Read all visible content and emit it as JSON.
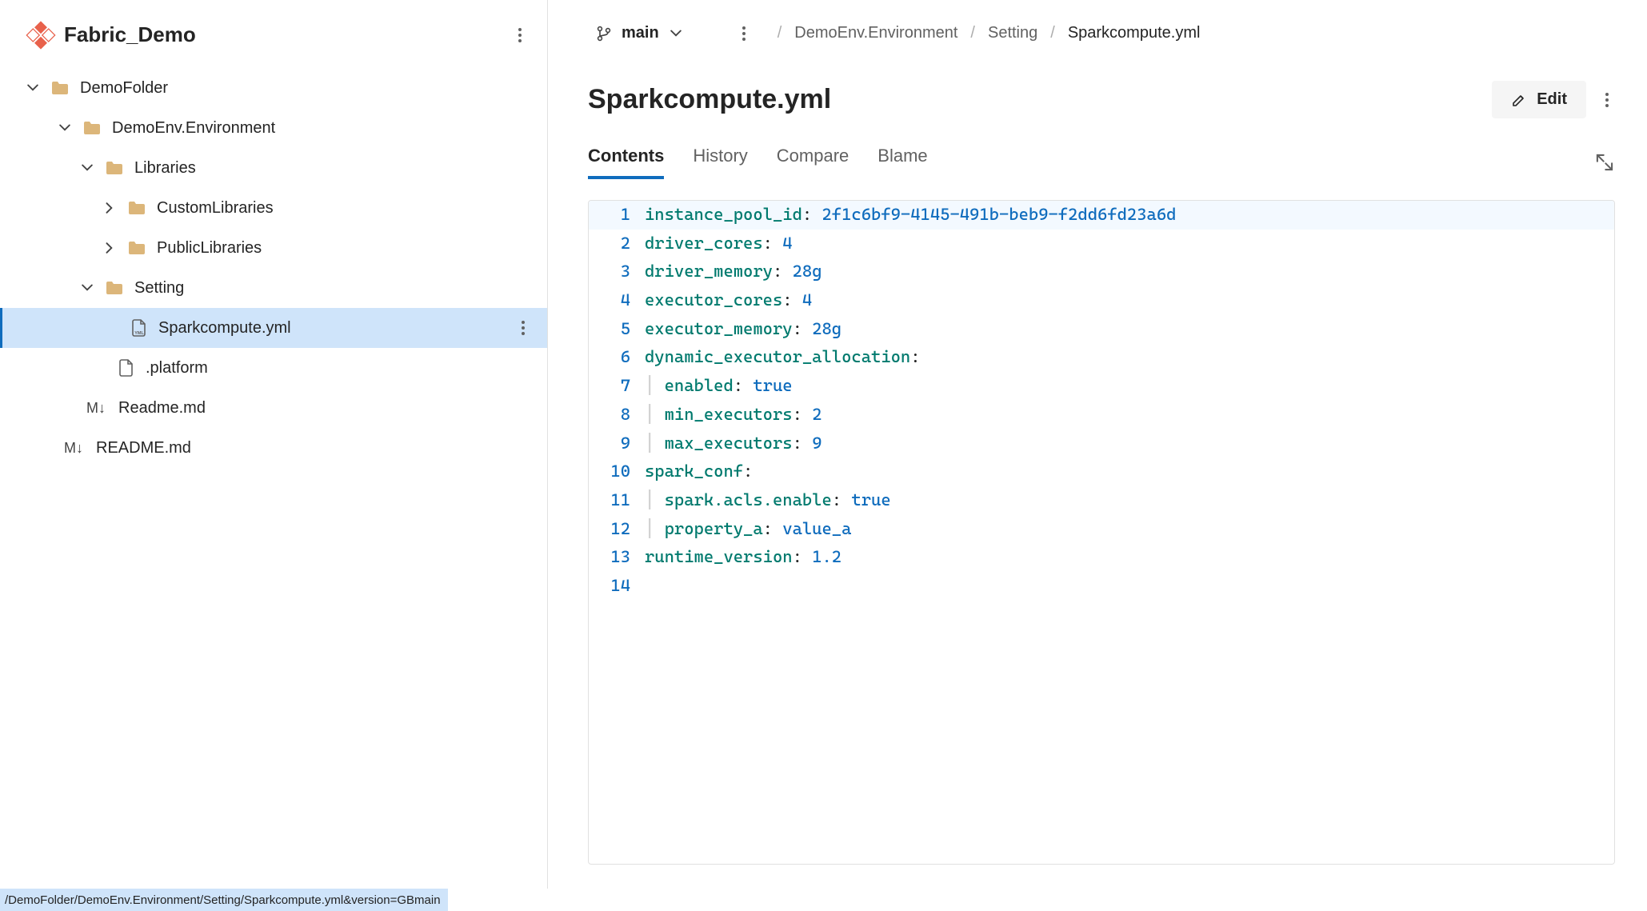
{
  "repo": {
    "name": "Fabric_Demo"
  },
  "tree": {
    "demofolder": {
      "label": "DemoFolder"
    },
    "demoenv": {
      "label": "DemoEnv.Environment"
    },
    "libraries": {
      "label": "Libraries"
    },
    "customlibs": {
      "label": "CustomLibraries"
    },
    "publiclibs": {
      "label": "PublicLibraries"
    },
    "setting": {
      "label": "Setting"
    },
    "sparkcompute": {
      "label": "Sparkcompute.yml"
    },
    "platform": {
      "label": ".platform"
    },
    "readme_inner": {
      "label": "Readme.md"
    },
    "readme_root": {
      "label": "README.md"
    }
  },
  "branch": {
    "label": "main"
  },
  "breadcrumb": {
    "seg1": "DemoEnv.Environment",
    "seg2": "Setting",
    "seg3": "Sparkcompute.yml"
  },
  "file": {
    "title": "Sparkcompute.yml"
  },
  "actions": {
    "edit": "Edit"
  },
  "tabs": {
    "contents": "Contents",
    "history": "History",
    "compare": "Compare",
    "blame": "Blame"
  },
  "code": {
    "l1_key": "instance_pool_id",
    "l1_val": "2f1c6bf9-4145-491b-beb9-f2dd6fd23a6d",
    "l2_key": "driver_cores",
    "l2_val": "4",
    "l3_key": "driver_memory",
    "l3_val": "28g",
    "l4_key": "executor_cores",
    "l4_val": "4",
    "l5_key": "executor_memory",
    "l5_val": "28g",
    "l6_key": "dynamic_executor_allocation",
    "l7_key": "enabled",
    "l7_val": "true",
    "l8_key": "min_executors",
    "l8_val": "2",
    "l9_key": "max_executors",
    "l9_val": "9",
    "l10_key": "spark_conf",
    "l11_key": "spark.acls.enable",
    "l11_val": "true",
    "l12_key": "property_a",
    "l12_val": "value_a",
    "l13_key": "runtime_version",
    "l13_val": "1.2",
    "ln1": "1",
    "ln2": "2",
    "ln3": "3",
    "ln4": "4",
    "ln5": "5",
    "ln6": "6",
    "ln7": "7",
    "ln8": "8",
    "ln9": "9",
    "ln10": "10",
    "ln11": "11",
    "ln12": "12",
    "ln13": "13",
    "ln14": "14"
  },
  "status": {
    "path": "/DemoFolder/DemoEnv.Environment/Setting/Sparkcompute.yml&version=GBmain"
  }
}
